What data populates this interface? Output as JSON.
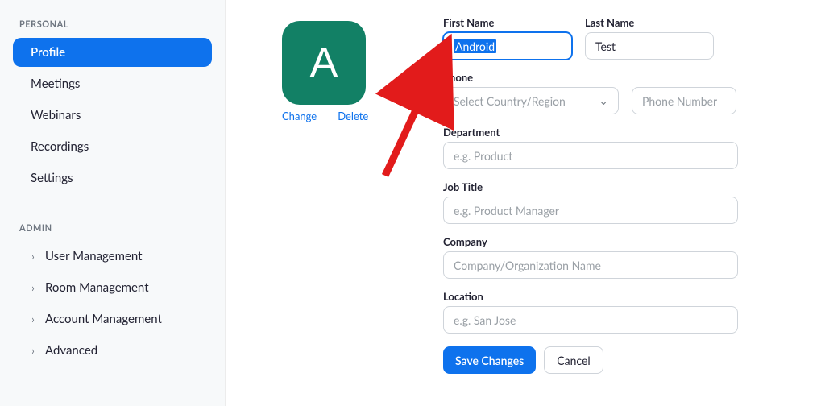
{
  "sidebar": {
    "personal": {
      "header": "PERSONAL",
      "items": [
        {
          "label": "Profile",
          "active": true
        },
        {
          "label": "Meetings"
        },
        {
          "label": "Webinars"
        },
        {
          "label": "Recordings"
        },
        {
          "label": "Settings"
        }
      ]
    },
    "admin": {
      "header": "ADMIN",
      "items": [
        {
          "label": "User Management"
        },
        {
          "label": "Room Management"
        },
        {
          "label": "Account Management"
        },
        {
          "label": "Advanced"
        }
      ]
    }
  },
  "avatar": {
    "letter": "A",
    "bg": "#128065",
    "change_label": "Change",
    "delete_label": "Delete"
  },
  "form": {
    "first_name": {
      "label": "First Name",
      "value": "Android"
    },
    "last_name": {
      "label": "Last Name",
      "value": "Test"
    },
    "phone": {
      "label": "Phone",
      "country_placeholder": "Select Country/Region",
      "number_placeholder": "Phone Number"
    },
    "department": {
      "label": "Department",
      "placeholder": "e.g. Product"
    },
    "job_title": {
      "label": "Job Title",
      "placeholder": "e.g. Product Manager"
    },
    "company": {
      "label": "Company",
      "placeholder": "Company/Organization Name"
    },
    "location": {
      "label": "Location",
      "placeholder": "e.g. San Jose"
    },
    "save_label": "Save Changes",
    "cancel_label": "Cancel"
  }
}
